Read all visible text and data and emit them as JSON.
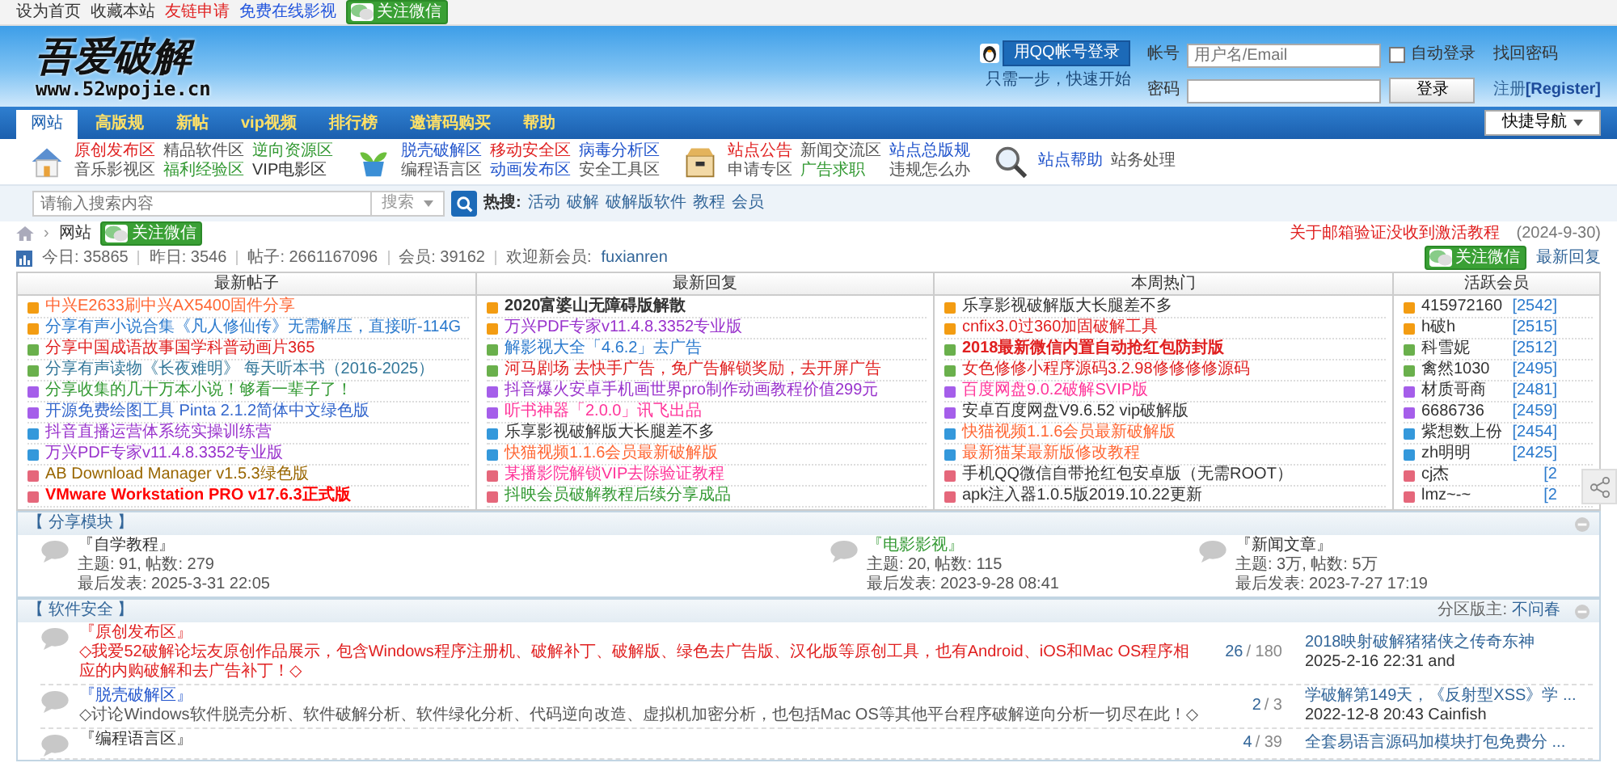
{
  "top_bar": {
    "links": [
      {
        "label": "设为首页",
        "color": "#333333"
      },
      {
        "label": "收藏本站",
        "color": "#333333"
      },
      {
        "label": "友链申请",
        "color": "#e02020"
      },
      {
        "label": "免费在线影视",
        "color": "#2255dd"
      }
    ],
    "wechat_button": "关注微信"
  },
  "header": {
    "logo_title": "吾爱破解",
    "logo_url": "www.52wpojie.cn",
    "qq_login": "用QQ帐号登录",
    "qq_hint": "只需一步，快速开始",
    "username_label": "帐号",
    "username_placeholder": "用户名/Email",
    "auto_login": {
      "label": "自动登录",
      "checked": false
    },
    "forgot": "找回密码",
    "password_label": "密码",
    "login_button": "登录",
    "register_prefix": "注册",
    "register": "[Register]"
  },
  "nav": {
    "items": [
      {
        "label": "网站",
        "selected": true
      },
      {
        "label": "高版规",
        "selected": false
      },
      {
        "label": "新帖",
        "selected": false
      },
      {
        "label": "vip视频",
        "selected": false
      },
      {
        "label": "排行榜",
        "selected": false
      },
      {
        "label": "邀请码购买",
        "selected": false
      },
      {
        "label": "帮助",
        "selected": false
      }
    ],
    "quick_nav": "快捷导航"
  },
  "quick_links": [
    {
      "kind": "house",
      "links": [
        {
          "label": "原创发布区",
          "color": "#e02020"
        },
        {
          "label": "精品软件区",
          "color": "#555555"
        },
        {
          "label": "逆向资源区",
          "color": "#339933"
        },
        {
          "label": "音乐影视区",
          "color": "#555555"
        },
        {
          "label": "福利经验区",
          "color": "#339933"
        },
        {
          "label": "VIP电影区",
          "color": "#333333"
        }
      ]
    },
    {
      "kind": "plant",
      "links": [
        {
          "label": "脱壳破解区",
          "color": "#2255cc"
        },
        {
          "label": "移动安全区",
          "color": "#e02020"
        },
        {
          "label": "病毒分析区",
          "color": "#2255cc"
        },
        {
          "label": "编程语言区",
          "color": "#555555"
        },
        {
          "label": "动画发布区",
          "color": "#2255cc"
        },
        {
          "label": "安全工具区",
          "color": "#555555"
        }
      ]
    },
    {
      "kind": "box",
      "links": [
        {
          "label": "站点公告",
          "color": "#e02020"
        },
        {
          "label": "新闻交流区",
          "color": "#555555"
        },
        {
          "label": "站点总版规",
          "color": "#2255cc"
        },
        {
          "label": "申请专区",
          "color": "#555555"
        },
        {
          "label": "广告求职",
          "color": "#339933"
        },
        {
          "label": "违规怎么办",
          "color": "#555555"
        }
      ]
    },
    {
      "kind": "magnifier",
      "links": [
        {
          "label": "站点帮助",
          "color": "#2255cc"
        },
        {
          "label": "站务处理",
          "color": "#555555"
        }
      ]
    }
  ],
  "search": {
    "placeholder": "请输入搜索内容",
    "scope": "搜索",
    "hot_label": "热搜:",
    "hot": [
      "活动",
      "破解",
      "破解版软件",
      "教程",
      "会员"
    ]
  },
  "breadcrumb": {
    "separator": "›",
    "current": "网站",
    "wechat_button": "关注微信"
  },
  "notice": {
    "title": "关于邮箱验证没收到激活教程",
    "date": "(2024-9-30)"
  },
  "stats": [
    "今日: 35865",
    "昨日: 3546",
    "帖子: 2661167096",
    "会员: 39162"
  ],
  "welcome_label": "欢迎新会员:",
  "new_member": "fuxianren",
  "side_actions": {
    "wechat_button": "关注微信",
    "latest_link": "最新回复"
  },
  "lists": [
    {
      "title": "最新帖子",
      "items": [
        {
          "text": "中兴E2633刷中兴AX5400固件分享",
          "color": "#ff6633",
          "bold": false
        },
        {
          "text": "分享有声小说合集《凡人修仙传》无需解压，直接听-114G",
          "color": "#2b7acd",
          "bold": false
        },
        {
          "text": "分享中国成语故事国学科普动画片365",
          "color": "#e02020",
          "bold": false
        },
        {
          "text": "分享有声读物《长夜难明》 每天听本书（2016-2025）",
          "color": "#337799",
          "bold": false
        },
        {
          "text": "分享收集的几十万本小说！够看一辈子了！",
          "color": "#339933",
          "bold": false
        },
        {
          "text": "开源免费绘图工具 Pinta 2.1.2简体中文绿色版",
          "color": "#3366cc",
          "bold": false
        },
        {
          "text": "抖音直播运营体系统实操训练营",
          "color": "#9933cc",
          "bold": false
        },
        {
          "text": "万兴PDF专家v11.4.8.3352专业版",
          "color": "#9933cc",
          "bold": false
        },
        {
          "text": "AB Download Manager v1.5.3绿色版",
          "color": "#996600",
          "bold": false
        },
        {
          "text": "VMware Workstation PRO v17.6.3正式版",
          "color": "#ff0000",
          "bold": true
        }
      ]
    },
    {
      "title": "最新回复",
      "items": [
        {
          "text": "2020富婆山无障碍版解散",
          "color": "#333333",
          "bold": true
        },
        {
          "text": "万兴PDF专家v11.4.8.3352专业版",
          "color": "#9933cc",
          "bold": false
        },
        {
          "text": "解影视大全「4.6.2」去广告",
          "color": "#2b7acd",
          "bold": false
        },
        {
          "text": "河马剧场 去快手广告，免广告解锁奖励，去开屏广告",
          "color": "#e02020",
          "bold": false
        },
        {
          "text": "抖音爆火安卓手机画世界pro制作动画教程价值299元",
          "color": "#9933cc",
          "bold": false
        },
        {
          "text": "听书神器「2.0.0」讯飞出品",
          "color": "#ff3399",
          "bold": false
        },
        {
          "text": "乐享影视破解版大长腿差不多",
          "color": "#333333",
          "bold": false
        },
        {
          "text": "快猫视频1.1.6会员最新破解版",
          "color": "#ff6633",
          "bold": false
        },
        {
          "text": "某播影院解锁VIP去除验证教程",
          "color": "#ff3399",
          "bold": false
        },
        {
          "text": "抖映会员破解教程后续分享成品",
          "color": "#339933",
          "bold": false
        }
      ]
    },
    {
      "title": "本周热门",
      "items": [
        {
          "text": "乐享影视破解版大长腿差不多",
          "color": "#333333",
          "bold": false
        },
        {
          "text": "cnfix3.0过360加固破解工具",
          "color": "#e02020",
          "bold": false
        },
        {
          "text": "2018最新微信内置自动抢红包防封版",
          "color": "#e02020",
          "bold": true
        },
        {
          "text": "女色修修小程序源码3.2.98修修修修源码",
          "color": "#e02020",
          "bold": false
        },
        {
          "text": "百度网盘9.0.2破解SVIP版",
          "color": "#ff3399",
          "bold": false
        },
        {
          "text": "安卓百度网盘V9.6.52 vip破解版",
          "color": "#333333",
          "bold": false
        },
        {
          "text": "快猫视频1.1.6会员最新破解版",
          "color": "#ff6633",
          "bold": false
        },
        {
          "text": "最新猫某最新版修改教程",
          "color": "#ff6633",
          "bold": false
        },
        {
          "text": "手机QQ微信自带抢红包安卓版（无需ROOT）",
          "color": "#333333",
          "bold": false
        },
        {
          "text": "apk注入器1.0.5版2019.10.22更新",
          "color": "#333333",
          "bold": false
        }
      ]
    }
  ],
  "members": {
    "title": "活跃会员",
    "items": [
      {
        "name": "415972160",
        "count": "[2542]"
      },
      {
        "name": "h破h",
        "count": "[2515]"
      },
      {
        "name": "科雪妮",
        "count": "[2512]"
      },
      {
        "name": "禽然1030",
        "count": "[2495]"
      },
      {
        "name": "材质哥商",
        "count": "[2481]"
      },
      {
        "name": "6686736",
        "count": "[2459]"
      },
      {
        "name": "紫想数上份",
        "count": "[2454]"
      },
      {
        "name": "zh明明",
        "count": "[2425]"
      },
      {
        "name": "cj杰",
        "count": "[2"
      },
      {
        "name": "lmz~-~",
        "count": "[2"
      }
    ]
  },
  "sections": [
    {
      "kind": "grid",
      "title": "【 分享模块 】",
      "forums": [
        {
          "name": "『自学教程』",
          "color": "#333333",
          "stats": "主题: 91, 帖数: 279",
          "last": "最后发表: 2025-3-31 22:05"
        },
        {
          "name": "『电影影视』",
          "color": "#339933",
          "stats": "主题: 20, 帖数: 115",
          "last": "最后发表: 2023-9-28 08:41"
        },
        {
          "name": "『新闻文章』",
          "color": "#333333",
          "stats": "主题: 3万, 帖数: 5万",
          "last": "最后发表: 2023-7-27 17:19"
        }
      ]
    },
    {
      "kind": "list",
      "title": "【 软件安全 】",
      "moderator_label": "分区版主:",
      "moderator": "不问春",
      "forums": [
        {
          "name": "『原创发布区』",
          "color": "#e02020",
          "desc": {
            "text": "◇我爱52破解论坛友原创作品展示，包含Windows程序注册机、破解补丁、破解版、绿色去广告版、汉化版等原创工具，也有Android、iOS和Mac OS程序相应的内购破解和去广告补丁！◇",
            "color": "#e02020"
          },
          "topics": "26",
          "posts": "/ 180",
          "last_title": "2018映射破解猪猪侠之传奇东神",
          "last_meta": "2025-2-16 22:31 and"
        },
        {
          "name": "『脱壳破解区』",
          "color": "#2255cc",
          "desc": {
            "text": "◇讨论Windows软件脱壳分析、软件破解分析、软件绿化分析、代码逆向改造、虚拟机加密分析，也包括Mac OS等其他平台程序破解逆向分析一切尽在此！◇",
            "color": "#555555"
          },
          "topics": "2",
          "posts": "/ 3",
          "last_title": "学破解第149天，《反射型XSS》学 ...",
          "last_meta": "2022-12-8 20:43 Cainfish"
        },
        {
          "name": "『编程语言区』",
          "color": "#333333",
          "topics": "4",
          "posts": "/ 39",
          "last_title": "全套易语言源码加模块打包免费分 ..."
        }
      ]
    }
  ]
}
